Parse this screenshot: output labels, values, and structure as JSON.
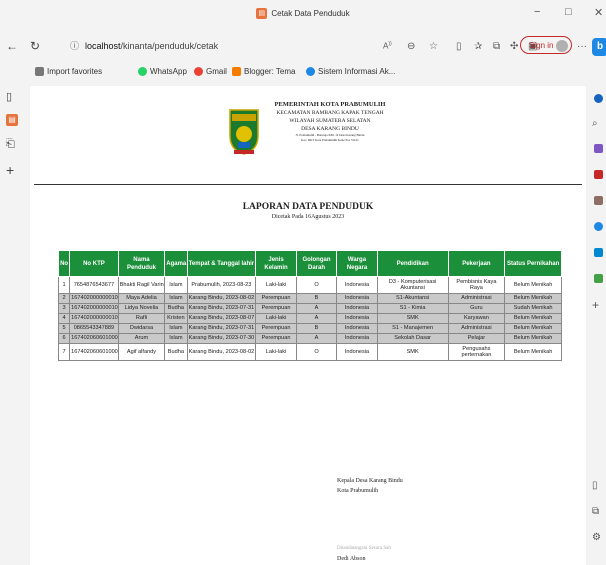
{
  "window": {
    "title": "Cetak Data Penduduk",
    "minimize": "−",
    "restore": "□",
    "close": "✕"
  },
  "browser": {
    "url_host": "localhost",
    "url_path": "/kinanta/penduduk/cetak",
    "sign_in": "Sign in",
    "more": "···",
    "copilot": "b"
  },
  "favorites": [
    {
      "label": "Import favorites",
      "color": "#777777"
    },
    {
      "label": "WhatsApp",
      "color": "#25d366"
    },
    {
      "label": "Gmail",
      "color": "#ea4335"
    },
    {
      "label": "Blogger: Tema",
      "color": "#f57c00"
    },
    {
      "label": "Sistem Informasi Ak...",
      "color": "#1e88e5"
    }
  ],
  "letterhead": {
    "line1": "PEMERINTAH KOTA PRABUMULIH",
    "line2": "KECAMATAN RAMBANG KAPAK TENGAH",
    "line3": "WILAYAH SUMATERA SELATAN",
    "line4": "DESA KARANG BINDU",
    "line5": "Jl. Prabumulih - Baturaja KM. 12 Desa Karang Bindu",
    "line6": "Kec. RKT Kota Prabumulih Kode Pos 31121"
  },
  "report": {
    "title": "LAPORAN DATA PENDUDUK",
    "subtitle": "Dicetak Pada 16Agustus 2023"
  },
  "table": {
    "headers": [
      "No",
      "No KTP",
      "Nama Penduduk",
      "Agama",
      "Tempat & Tanggal lahir",
      "Jenis Kelamin",
      "Golongan Darah",
      "Warga Negara",
      "Pendidikan",
      "Pekerjaan",
      "Status Pernikahan"
    ],
    "rows": [
      [
        "1",
        "7654876543677",
        "Bhakti Ragil Varina",
        "Islam",
        "Prabumulih, 2023-08-23",
        "Laki-laki",
        "O",
        "Indonesia",
        "D3 - Komputerisasi Akuntansi",
        "Pembisnis Kaya Raya",
        "Belum Menikah"
      ],
      [
        "2",
        "1674020000000101",
        "Maya Adelia",
        "Islam",
        "Karang Bindu, 2023-08-02",
        "Perempuan",
        "B",
        "Indonesia",
        "S1-Akuntansi",
        "Administrasi",
        "Belum Menikah"
      ],
      [
        "3",
        "1674020000000101",
        "Lidya Novelia",
        "Budha",
        "Karang Bindu, 2023-07-31",
        "Perempuan",
        "A",
        "Indonesia",
        "S1 - Kimia",
        "Guru",
        "Sudah Menikah"
      ],
      [
        "4",
        "1674020000000101",
        "Rafli",
        "Kristen",
        "Karang Bindu, 2023-08-07",
        "Laki-laki",
        "A",
        "Indonesia",
        "SMK",
        "Karyawan",
        "Belum Menikah"
      ],
      [
        "5",
        "0865543347889",
        "Dwidarsa",
        "Islam",
        "Karang Bindu, 2023-07-31",
        "Perempuan",
        "B",
        "Indonesia",
        "S1 - Manajemen",
        "Administrasi",
        "Belum Menikah"
      ],
      [
        "6",
        "1674020606010007",
        "Arum",
        "Islam",
        "Karang Bindu, 2023-07-30",
        "Perempuan",
        "A",
        "Indonesia",
        "Sekolah Dasar",
        "Pelajar",
        "Belum Menikah"
      ],
      [
        "7",
        "1674020606010007",
        "Agif alfandy",
        "Budha",
        "Karang Bindu, 2023-08-02",
        "Laki-laki",
        "O",
        "Indonesia",
        "SMK",
        "Pengusahs perternakan",
        "Belum Menikah"
      ]
    ]
  },
  "signature": {
    "role": "Kepala Desa Karang Bindu",
    "place": "Kota Prabumulih",
    "note": "Ditandatangani Secara Sah",
    "name": "Dedi Abson"
  },
  "colors": {
    "header_green": "#1b8f3a",
    "row_gray": "#c9c9c9",
    "signin_red": "#c62828"
  }
}
